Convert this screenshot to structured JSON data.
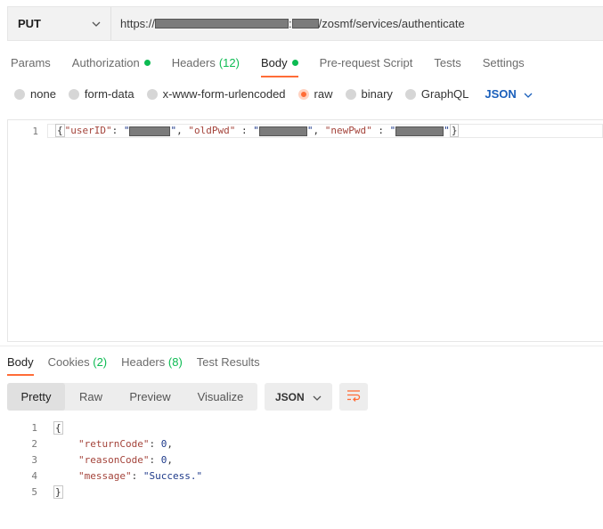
{
  "request": {
    "method": "PUT",
    "url_prefix": "https://",
    "url_suffix": "/zosmf/services/authenticate",
    "url_separator": ":"
  },
  "request_tabs": [
    {
      "label": "Params"
    },
    {
      "label": "Authorization"
    },
    {
      "label": "Headers",
      "count": "(12)"
    },
    {
      "label": "Body"
    },
    {
      "label": "Pre-request Script"
    },
    {
      "label": "Tests"
    },
    {
      "label": "Settings"
    }
  ],
  "body_types": [
    "none",
    "form-data",
    "x-www-form-urlencoded",
    "raw",
    "binary",
    "GraphQL"
  ],
  "body_language": "JSON",
  "request_body": {
    "line_number": "1",
    "open": "{",
    "key1": "\"userID\"",
    "key2": "\"oldPwd\"",
    "key3": "\"newPwd\"",
    "colon": ":",
    "comma": ",",
    "quote": "\"",
    "close": "}"
  },
  "response_tabs": [
    {
      "label": "Body"
    },
    {
      "label": "Cookies",
      "count": "(2)"
    },
    {
      "label": "Headers",
      "count": "(8)"
    },
    {
      "label": "Test Results"
    }
  ],
  "view_tabs": [
    "Pretty",
    "Raw",
    "Preview",
    "Visualize"
  ],
  "response_format": "JSON",
  "response_body": {
    "line_numbers": [
      "1",
      "2",
      "3",
      "4",
      "5"
    ],
    "open": "{",
    "close": "}",
    "returnCode_key": "\"returnCode\"",
    "returnCode_val": "0",
    "reasonCode_key": "\"reasonCode\"",
    "reasonCode_val": "0",
    "message_key": "\"message\"",
    "message_val": "\"Success.\""
  },
  "colors": {
    "accent": "#ff6c37",
    "status_dot": "#0cbb52",
    "language_link": "#1a5fbb"
  }
}
